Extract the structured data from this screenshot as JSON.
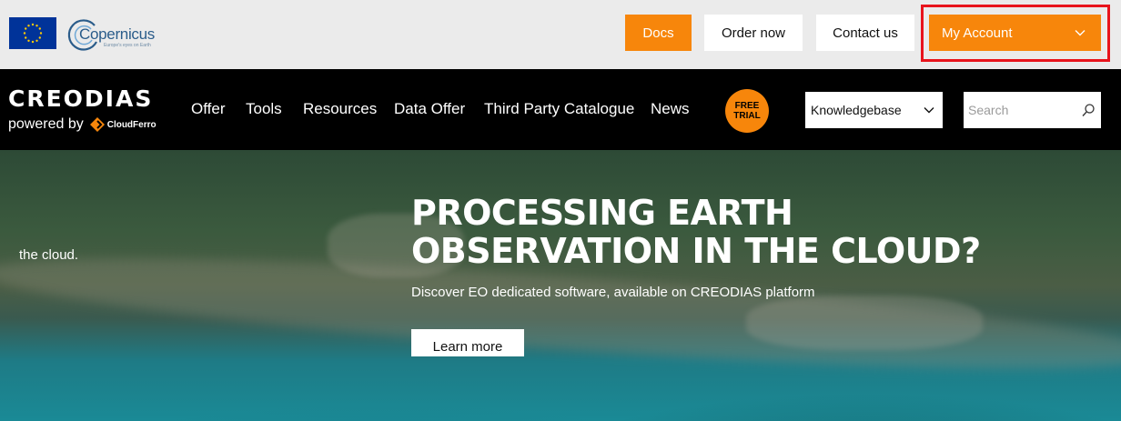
{
  "topbar": {
    "copernicus_name": "Copernicus",
    "copernicus_tagline": "Europe's eyes on Earth",
    "buttons": {
      "docs": "Docs",
      "order": "Order now",
      "contact": "Contact us",
      "account": "My Account"
    },
    "accent": "#f7860b",
    "highlight": "#e8141c"
  },
  "navbar": {
    "brand": "CREODIAS",
    "powered_by": "powered by",
    "partner": "CloudFerro",
    "items": [
      "Offer",
      "Tools",
      "Resources",
      "Data Offer",
      "Third Party Catalogue",
      "News"
    ],
    "free_trial": [
      "FREE",
      "TRIAL"
    ],
    "kb_select_value": "Knowledgebase",
    "search_placeholder": "Search"
  },
  "hero": {
    "side_text": "the cloud.",
    "title_lines": [
      "PROCESSING EARTH",
      "OBSERVATION IN THE CLOUD?"
    ],
    "subtitle": "Discover EO dedicated software, available on CREODIAS platform",
    "cta": "Learn more"
  }
}
